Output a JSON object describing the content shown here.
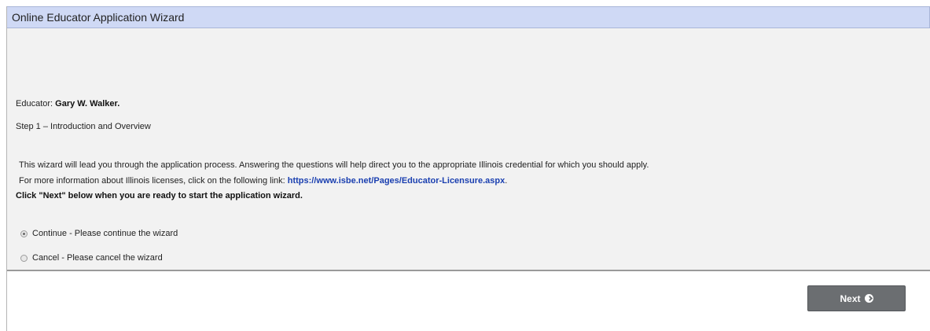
{
  "header": {
    "title": "Online Educator Application Wizard"
  },
  "educator": {
    "label": "Educator: ",
    "name": "Gary W. Walker."
  },
  "step": {
    "text": "Step 1 – Introduction and Overview"
  },
  "intro": {
    "line1": "This wizard will lead you through the application process. Answering the questions will help direct you to the appropriate Illinois credential for which you should apply.",
    "line2_prefix": "For more information about Illinois licenses, click on the following link: ",
    "link_text": "https://www.isbe.net/Pages/Educator-Licensure.aspx",
    "line2_suffix": ".",
    "line3": "Click \"Next\" below when you are ready to start the application wizard."
  },
  "options": {
    "continue_label": "Continue - Please continue the wizard",
    "cancel_label": "Cancel - Please cancel the wizard",
    "selected": "continue"
  },
  "footer": {
    "next_label": "Next",
    "next_icon": "chevron-circle-right-icon"
  }
}
